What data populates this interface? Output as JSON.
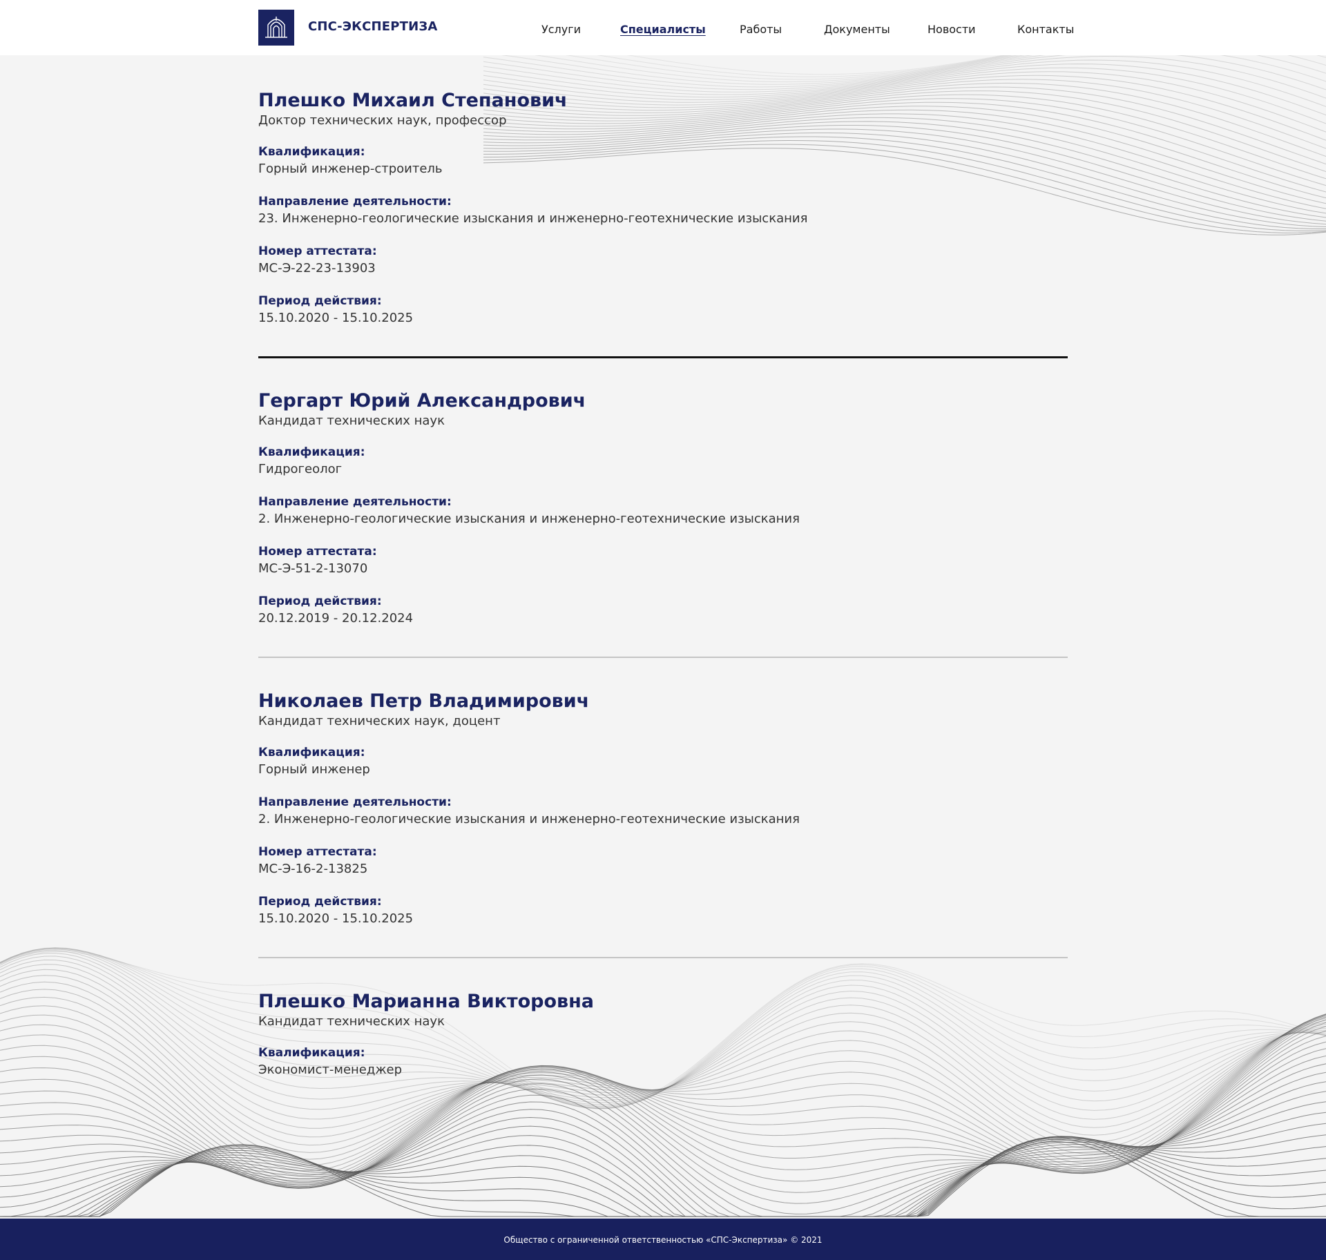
{
  "header": {
    "brand": "СПС-ЭКСПЕРТИЗА",
    "nav": [
      {
        "label": "Услуги",
        "active": false
      },
      {
        "label": "Специалисты",
        "active": true
      },
      {
        "label": "Работы",
        "active": false
      },
      {
        "label": "Документы",
        "active": false
      },
      {
        "label": "Новости",
        "active": false
      },
      {
        "label": "Контакты",
        "active": false
      }
    ]
  },
  "colors": {
    "brand": "#1a2361",
    "footer_bg": "#18205e",
    "page_bg": "#f4f4f4"
  },
  "labels": {
    "qualification": "Квалификация:",
    "direction": "Направление деятельности:",
    "certificate": "Номер аттестата:",
    "period": "Период действия:"
  },
  "specialists": [
    {
      "name": "Плешко Михаил Степанович",
      "degree": "Доктор технических наук, профессор",
      "qualification": "Горный инженер-строитель",
      "direction": "23. Инженерно-геологические изыскания и инженерно-геотехнические изыскания",
      "certificate": "МС-Э-22-23-13903",
      "period": "15.10.2020 - 15.10.2025"
    },
    {
      "name": "Гергарт Юрий Александрович",
      "degree": "Кандидат технических наук",
      "qualification": "Гидрогеолог",
      "direction": "2. Инженерно-геологические изыскания и инженерно-геотехнические изыскания",
      "certificate": "МС-Э-51-2-13070",
      "period": "20.12.2019 - 20.12.2024"
    },
    {
      "name": "Николаев Петр Владимирович",
      "degree": "Кандидат технических наук, доцент",
      "qualification": "Горный инженер",
      "direction": "2. Инженерно-геологические изыскания и инженерно-геотехнические изыскания",
      "certificate": "МС-Э-16-2-13825",
      "period": "15.10.2020 - 15.10.2025"
    },
    {
      "name": "Плешко Марианна Викторовна",
      "degree": "Кандидат технических наук",
      "qualification": "Экономист-менеджер"
    }
  ],
  "footer": {
    "text": "Общество с ограниченной ответственностью «СПС-Экспертиза»   © 2021"
  }
}
